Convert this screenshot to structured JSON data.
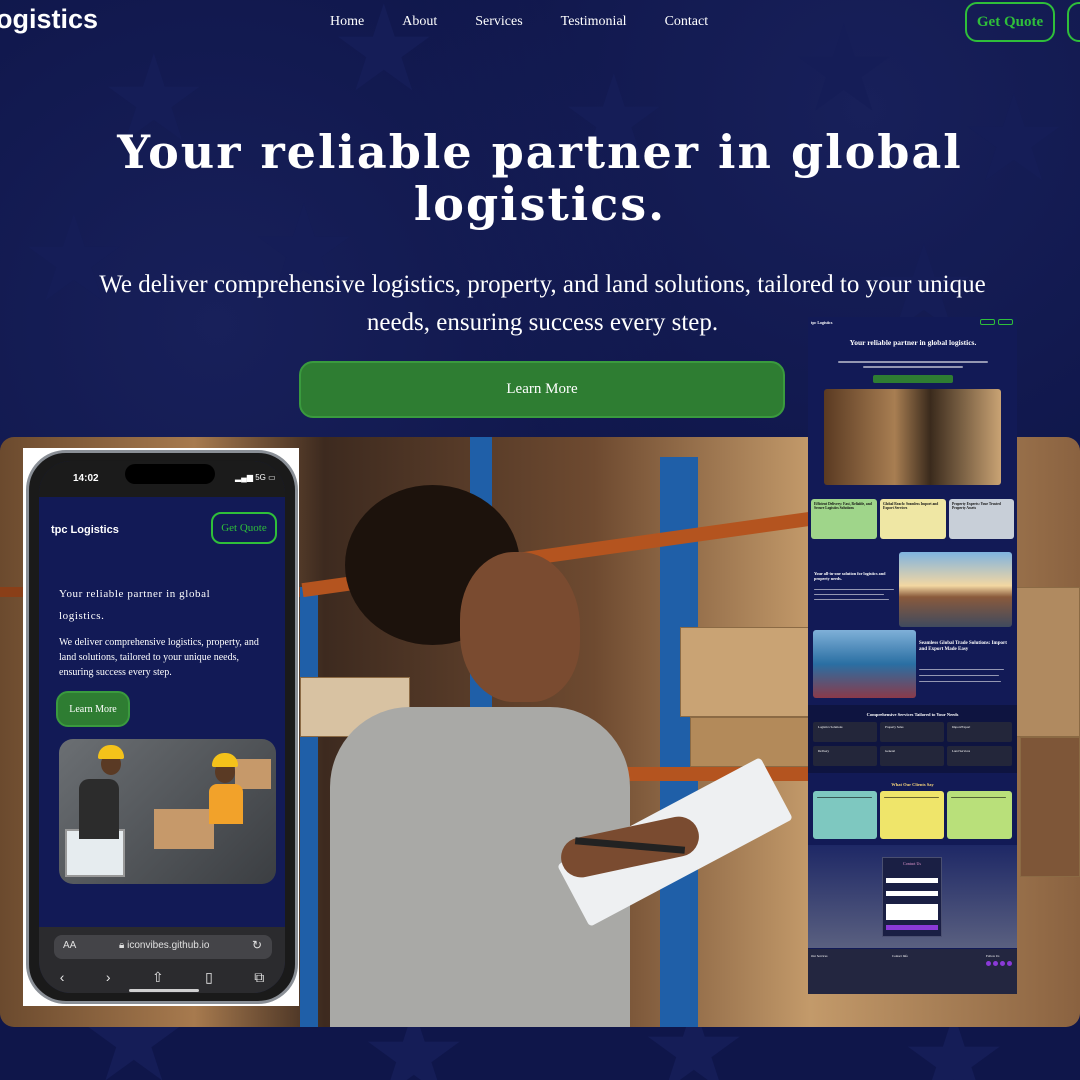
{
  "header": {
    "brand": "ogistics",
    "nav": [
      "Home",
      "About",
      "Services",
      "Testimonial",
      "Contact"
    ],
    "quote_label": "Get Quote"
  },
  "hero": {
    "title": "Your reliable partner in global logistics.",
    "subtitle": "We deliver comprehensive logistics, property, and land solutions, tailored to your unique needs, ensuring success every step.",
    "cta_label": "Learn More"
  },
  "phone": {
    "time": "14:02",
    "signal": "5G",
    "brand": "tpc Logistics",
    "quote_label": "Get Quote",
    "title": "Your reliable partner in global logistics.",
    "subtitle": "We deliver comprehensive logistics, property, and land solutions, tailored to your unique needs, ensuring success every step.",
    "cta_label": "Learn More",
    "aa_label": "AA",
    "url": "iconvibes.github.io"
  },
  "mockup": {
    "brand": "tpc Logistics",
    "title": "Your reliable partner in global logistics.",
    "cards": [
      "Efficient Delivery: Fast, Reliable, and Secure Logistics Solutions",
      "Global Reach: Seamless Import and Export Services",
      "Property Experts: Your Trusted Property Assets"
    ],
    "section1": "Your all-in-one solution for logistics and property needs.",
    "section2": "Seamless Global Trade Solutions: Import and Export Made Easy",
    "services_title": "Comprehensive Services Tailored to Your Needs",
    "services": [
      "Logistics Solutions",
      "Property Sales",
      "Import/Export",
      "Delivery",
      "General",
      "Land Services"
    ],
    "testimonials_title": "What Our Clients Say",
    "contact_title": "Contact Us",
    "footer": [
      "Our Services",
      "Contact Info",
      "Follow Us"
    ]
  },
  "colors": {
    "background": "#0f164a",
    "accent_green": "#2fbf3a",
    "button_green": "#2e7d32"
  }
}
